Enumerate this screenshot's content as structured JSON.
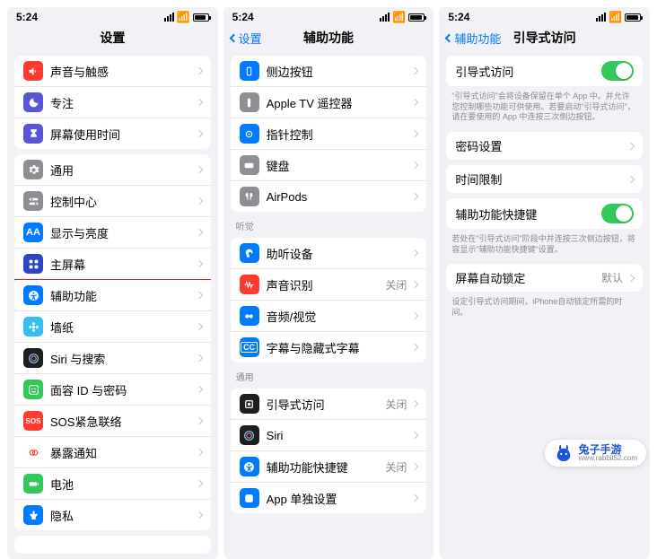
{
  "s1": {
    "time": "5:24",
    "title": "设置",
    "g1": [
      {
        "label": "声音与触感",
        "ic": "#ff3b30",
        "t": "speaker"
      },
      {
        "label": "专注",
        "ic": "#5856d6",
        "t": "moon"
      },
      {
        "label": "屏幕使用时间",
        "ic": "#5856d6",
        "t": "hourglass"
      }
    ],
    "g2": [
      {
        "label": "通用",
        "ic": "#8e8e93",
        "t": "gear"
      },
      {
        "label": "控制中心",
        "ic": "#8e8e93",
        "t": "switches"
      },
      {
        "label": "显示与亮度",
        "ic": "#007aff",
        "t": "aa"
      },
      {
        "label": "主屏幕",
        "ic": "#2e46c5",
        "t": "grid"
      },
      {
        "label": "辅助功能",
        "ic": "#007aff",
        "t": "acc",
        "hl": true
      },
      {
        "label": "墙纸",
        "ic": "#38bdf0",
        "t": "flower"
      },
      {
        "label": "Siri 与搜索",
        "ic": "#1f1f1f",
        "t": "siri"
      },
      {
        "label": "面容 ID 与密码",
        "ic": "#34c759",
        "t": "face"
      },
      {
        "label": "SOS紧急联络",
        "ic": "#ff3b30",
        "t": "sos"
      },
      {
        "label": "暴露通知",
        "ic": "#fff",
        "t": "exp",
        "fg": "#ff3b30"
      },
      {
        "label": "电池",
        "ic": "#34c759",
        "t": "battery"
      },
      {
        "label": "隐私",
        "ic": "#007aff",
        "t": "hand"
      }
    ]
  },
  "s2": {
    "time": "5:24",
    "title": "辅助功能",
    "back": "设置",
    "g1": [
      {
        "label": "侧边按钮",
        "ic": "#007aff",
        "t": "square"
      },
      {
        "label": "Apple TV 遥控器",
        "ic": "#8e8e93",
        "t": "remote"
      },
      {
        "label": "指针控制",
        "ic": "#007aff",
        "t": "pointer"
      },
      {
        "label": "键盘",
        "ic": "#8e8e93",
        "t": "kb"
      },
      {
        "label": "AirPods",
        "ic": "#8e8e93",
        "t": "airpods"
      }
    ],
    "h2": "听觉",
    "g2": [
      {
        "label": "助听设备",
        "ic": "#007aff",
        "t": "ear"
      },
      {
        "label": "声音识别",
        "ic": "#ff3b30",
        "t": "wave",
        "val": "关闭"
      },
      {
        "label": "音频/视觉",
        "ic": "#007aff",
        "t": "audio"
      },
      {
        "label": "字幕与隐藏式字幕",
        "ic": "#007aff",
        "t": "cc"
      }
    ],
    "h3": "通用",
    "g3": [
      {
        "label": "引导式访问",
        "ic": "#1f1f1f",
        "t": "guide",
        "val": "关闭",
        "hl": true
      },
      {
        "label": "Siri",
        "ic": "#1f1f1f",
        "t": "siri"
      },
      {
        "label": "辅助功能快捷键",
        "ic": "#007aff",
        "t": "acc",
        "val": "关闭"
      },
      {
        "label": "App 单独设置",
        "ic": "#007aff",
        "t": "app"
      }
    ]
  },
  "s3": {
    "time": "5:24",
    "title": "引导式访问",
    "back": "辅助功能",
    "g1": [
      {
        "label": "引导式访问",
        "toggle": true,
        "hl": true
      }
    ],
    "hint1": "\"引导式访问\"会将设备保留在单个 App 中。并允许您控制哪些功能可供使用。若要启动\"引导式访问\"，请在要使用的 App 中连按三次侧边按钮。",
    "g2": [
      {
        "label": "密码设置"
      }
    ],
    "g3": [
      {
        "label": "时间限制"
      }
    ],
    "g4": [
      {
        "label": "辅助功能快捷键",
        "toggle": true,
        "hl": true
      }
    ],
    "hint4": "若处在\"引导式访问\"阶段中并连按三次侧边按钮，将容显示\"辅助功能快捷键\"设置。",
    "g5": [
      {
        "label": "屏幕自动锁定",
        "val": "默认"
      }
    ],
    "hint5": "设定引导式访问期间，iPhone自动锁定所需的时间。"
  },
  "logo": {
    "name": "兔子手游",
    "url": "www.rabbit52.com"
  }
}
